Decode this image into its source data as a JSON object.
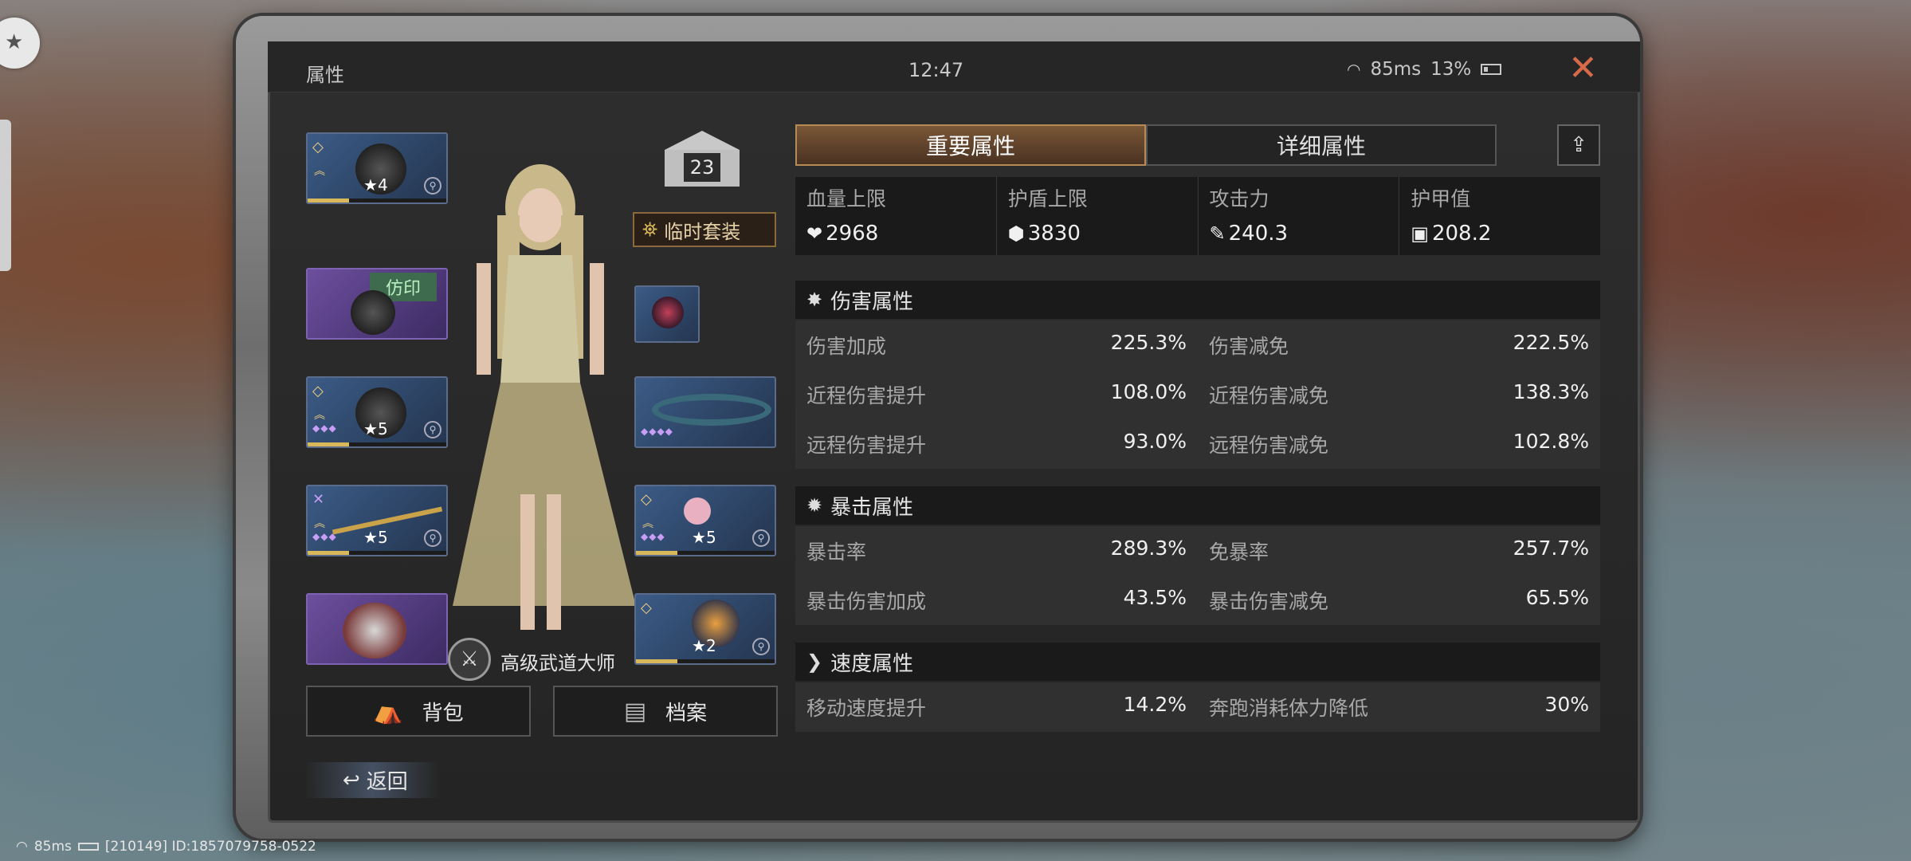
{
  "window": {
    "title": "属性",
    "clock": "12:47",
    "ping": "85ms",
    "battery": "13%"
  },
  "footer": {
    "ping": "85ms",
    "id_text": "[210149] ID:1857079758-0522"
  },
  "character": {
    "level": "23",
    "temp_set_label": "临时套装",
    "rank_title": "高级武道大师"
  },
  "slots": {
    "helmet": {
      "stars": "4"
    },
    "mask": {
      "tag": "仿印"
    },
    "armor": {
      "stars": "5",
      "dots": "◆◆◆"
    },
    "weapon": {
      "stars": "5",
      "dots": "◆◆◆"
    },
    "bracelet": {
      "dots": "◆◆◆◆"
    },
    "wand": {
      "stars": "5",
      "dots": "◆◆◆"
    },
    "mech": {
      "stars": "2"
    }
  },
  "buttons": {
    "bag": "背包",
    "archive": "档案",
    "back": "返回"
  },
  "tabs": {
    "important": "重要属性",
    "detailed": "详细属性"
  },
  "key_stats": [
    {
      "label": "血量上限",
      "value": "2968",
      "icon": "❤"
    },
    {
      "label": "护盾上限",
      "value": "3830",
      "icon": "⬢"
    },
    {
      "label": "攻击力",
      "value": "240.3",
      "icon": "✎"
    },
    {
      "label": "护甲值",
      "value": "208.2",
      "icon": "▣"
    }
  ],
  "sections": {
    "damage": {
      "title": "伤害属性",
      "rows": [
        [
          {
            "k": "伤害加成",
            "v": "225.3%"
          },
          {
            "k": "伤害减免",
            "v": "222.5%"
          }
        ],
        [
          {
            "k": "近程伤害提升",
            "v": "108.0%"
          },
          {
            "k": "近程伤害减免",
            "v": "138.3%"
          }
        ],
        [
          {
            "k": "远程伤害提升",
            "v": "93.0%"
          },
          {
            "k": "远程伤害减免",
            "v": "102.8%"
          }
        ]
      ]
    },
    "crit": {
      "title": "暴击属性",
      "rows": [
        [
          {
            "k": "暴击率",
            "v": "289.3%"
          },
          {
            "k": "免暴率",
            "v": "257.7%"
          }
        ],
        [
          {
            "k": "暴击伤害加成",
            "v": "43.5%"
          },
          {
            "k": "暴击伤害减免",
            "v": "65.5%"
          }
        ]
      ]
    },
    "speed": {
      "title": "速度属性",
      "rows": [
        [
          {
            "k": "移动速度提升",
            "v": "14.2%"
          },
          {
            "k": "奔跑消耗体力降低",
            "v": "30%"
          }
        ]
      ]
    }
  }
}
